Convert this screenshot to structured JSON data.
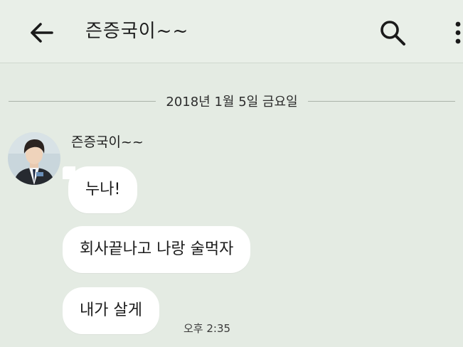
{
  "header": {
    "title": "즌증국이~~",
    "back_icon": "back-arrow-icon",
    "search_icon": "search-icon",
    "menu_icon": "more-vertical-icon"
  },
  "chat": {
    "date_divider": "2018년 1월 5일 금요일",
    "sender_name": "즌증국이~~",
    "messages": [
      {
        "text": "누나!"
      },
      {
        "text": "회사끝나고 나랑 술먹자"
      },
      {
        "text": "내가 살게"
      }
    ],
    "last_time": "오후 2:35"
  },
  "colors": {
    "background": "#e4ebe3",
    "bubble": "#ffffff",
    "text": "#1c1c1c"
  }
}
